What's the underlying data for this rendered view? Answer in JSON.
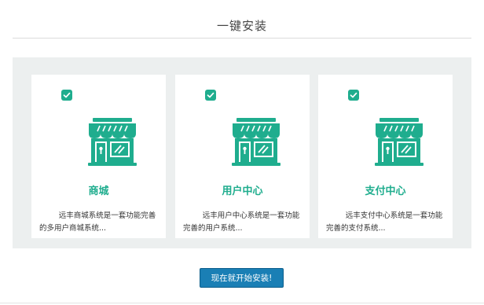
{
  "header": {
    "title": "一键安装"
  },
  "modules": [
    {
      "title": "商城",
      "description": "远丰商城系统是一套功能完善的多用户商城系统...",
      "checked": true,
      "icon": "store-icon"
    },
    {
      "title": "用户中心",
      "description": "远丰用户中心系统是一套功能完善的用户系统...",
      "checked": true,
      "icon": "store-icon"
    },
    {
      "title": "支付中心",
      "description": "远丰支付中心系统是一套功能完善的支付系统...",
      "checked": true,
      "icon": "store-icon"
    }
  ],
  "actions": {
    "install_label": "现在就开始安装!"
  },
  "colors": {
    "accent": "#1fad8e",
    "button": "#1a7fb5",
    "panel_bg": "#ecefef"
  }
}
